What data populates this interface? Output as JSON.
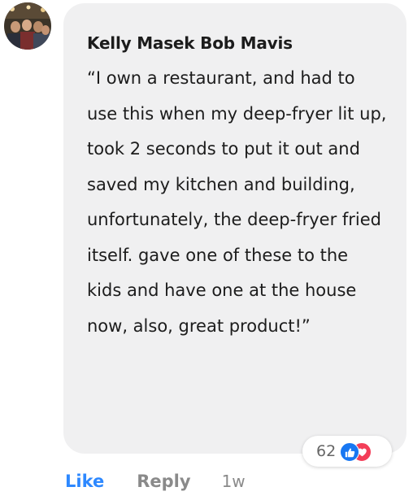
{
  "comment": {
    "author": "Kelly Masek Bob Mavis",
    "text": "“I own a restaurant, and had to use this when my deep-fryer lit up, took 2 seconds to put it out and saved my kitchen and building, unfortunately, the deep-fryer fried itself. gave one of these to the kids and have one at the house now, also, great product!”",
    "reaction_count": "62",
    "reaction_icons": [
      "like-icon",
      "love-icon"
    ],
    "actions": {
      "like": "Like",
      "reply": "Reply",
      "time": "1w"
    }
  },
  "colors": {
    "bubble": "#f0f0f1",
    "like_action": "#2d88ff",
    "like_reaction": "#1877f2",
    "love_reaction": "#f33e58",
    "muted": "#8a8a8a"
  }
}
